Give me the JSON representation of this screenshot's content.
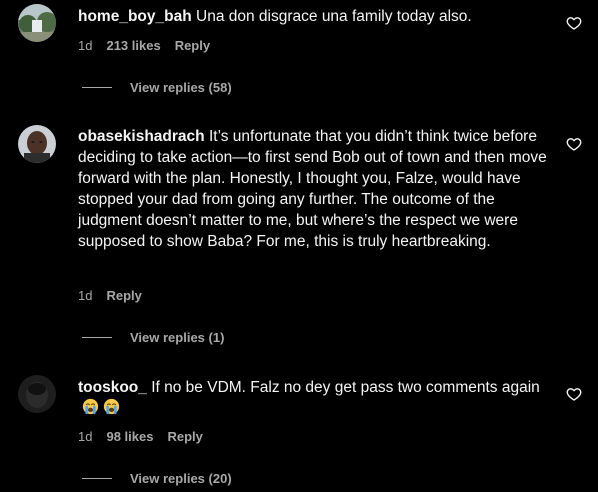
{
  "comments": [
    {
      "username": "home_boy_bah",
      "text": "Una don disgrace una family today also.",
      "time": "1d",
      "likes": "213 likes",
      "reply_label": "Reply",
      "view_replies": "View replies (58)",
      "like_icon": "heart-outline-icon"
    },
    {
      "username": "obasekishadrach",
      "text": "It’s unfortunate that you didn’t think twice before deciding to take action—to first send Bob out of town and then move forward with the plan. Honestly, I thought you, Falze, would have stopped your dad from going any further. The outcome of the judgment doesn’t matter to me, but where’s the respect we were supposed to show Baba? For me, this is truly heartbreaking.",
      "time": "1d",
      "reply_label": "Reply",
      "view_replies": "View replies (1)",
      "like_icon": "heart-outline-icon"
    },
    {
      "username": "tooskoo_",
      "text": "If no be VDM. Falz no dey get pass two comments again",
      "emojis": [
        "😭",
        "😭"
      ],
      "time": "1d",
      "likes": "98 likes",
      "reply_label": "Reply",
      "view_replies": "View replies (20)",
      "like_icon": "heart-outline-icon"
    }
  ],
  "colors": {
    "background": "#000000",
    "primary_text": "#f5f5f5",
    "secondary_text": "#a8a8a8",
    "emoji_face": "#f7c948",
    "emoji_tears": "#4aa3ff"
  }
}
